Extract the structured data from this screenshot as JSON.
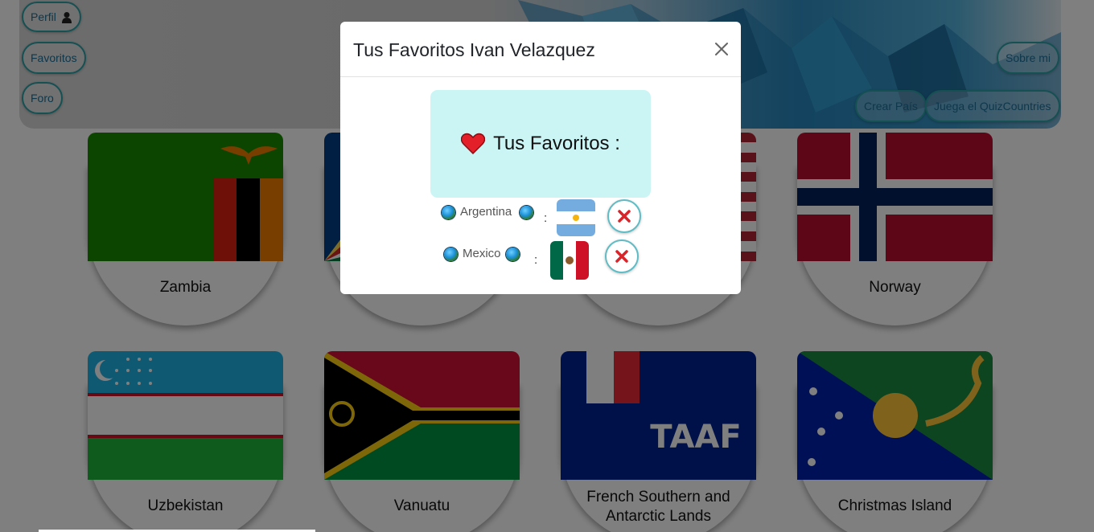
{
  "nav": {
    "perfil": "Perfil",
    "favoritos": "Favoritos",
    "foro": "Foro",
    "sobre_mi": "Sobre mi",
    "crear_pais": "Crear País",
    "quiz": "Juega el QuizCountries"
  },
  "cards": [
    {
      "name": "Zambia"
    },
    {
      "name": ""
    },
    {
      "name": ""
    },
    {
      "name": "Norway"
    },
    {
      "name": "Uzbekistan"
    },
    {
      "name": "Vanuatu"
    },
    {
      "name": "French Southern and Antarctic Lands"
    },
    {
      "name": "Christmas Island"
    }
  ],
  "modal": {
    "title": "Tus Favoritos Ivan Velazquez",
    "close_icon": "close-icon",
    "heading": "Tus Favoritos :",
    "heart_icon": "heart-icon",
    "favorites": [
      {
        "country": "Argentina",
        "separator": ":",
        "remove_icon": "cross-icon"
      },
      {
        "country": "Mexico",
        "separator": ":",
        "remove_icon": "cross-icon"
      }
    ]
  },
  "colors": {
    "accent": "#2aa0a7",
    "fav_box_bg": "#cbf5f5",
    "remove_x": "#d9252a"
  }
}
